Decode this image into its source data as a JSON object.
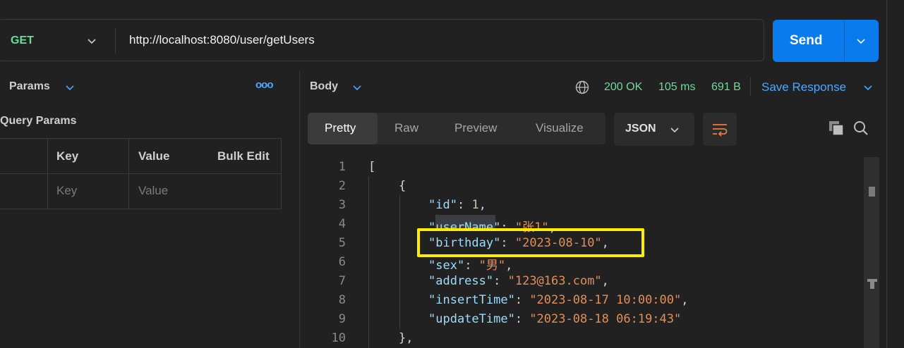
{
  "request": {
    "method": "GET",
    "url": "http://localhost:8080/user/getUsers",
    "send_label": "Send"
  },
  "left_pane": {
    "tab_label": "Params",
    "more_label": "ooo",
    "section_title": "Query Params",
    "columns": [
      "Key",
      "Value",
      "Bulk Edit"
    ],
    "placeholders": {
      "key": "Key",
      "value": "Value"
    }
  },
  "response": {
    "section_label": "Body",
    "status": "200 OK",
    "time": "105 ms",
    "size": "691 B",
    "save_label": "Save Response",
    "tabs": [
      "Pretty",
      "Raw",
      "Preview",
      "Visualize"
    ],
    "active_tab": "Pretty",
    "format": "JSON"
  },
  "code": {
    "line_numbers": [
      "1",
      "2",
      "3",
      "4",
      "5",
      "6",
      "7",
      "8",
      "9",
      "10"
    ],
    "lines": [
      "[",
      "{",
      "\"id\": 1,",
      "\"userName\": \"张1\",",
      "\"birthday\": \"2023-08-10\",",
      "\"sex\": \"男\",",
      "\"address\": \"123@163.com\",",
      "\"insertTime\": \"2023-08-17 10:00:00\",",
      "\"updateTime\": \"2023-08-18 06:19:43\"",
      "},"
    ]
  },
  "colors": {
    "accent_blue": "#097bed",
    "status_green": "#6bdd9a",
    "json_key": "#9cdcfe",
    "json_string": "#e08f5a",
    "highlight_box": "#ffec00"
  }
}
